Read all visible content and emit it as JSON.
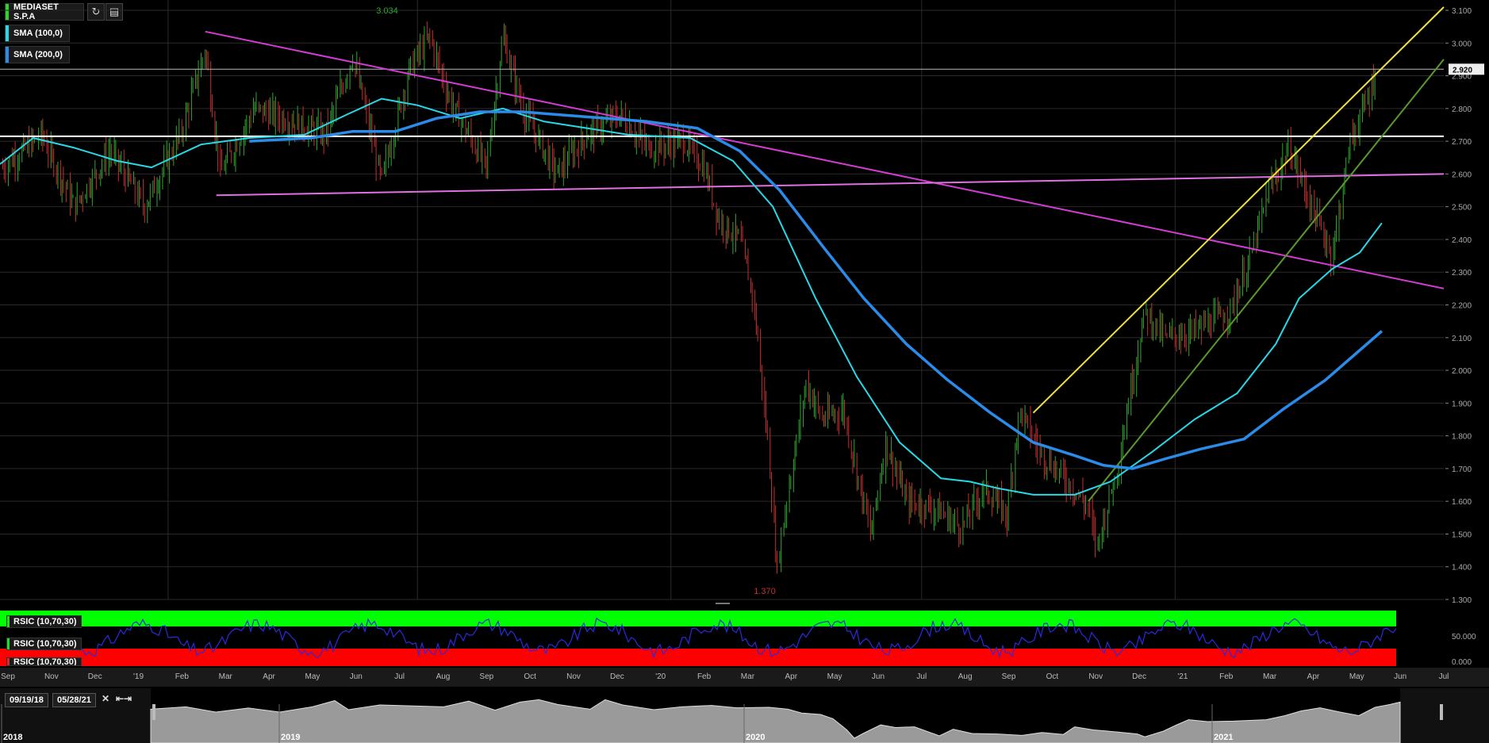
{
  "header": {
    "symbol": "MEDIASET S.P.A",
    "refresh_icon": "refresh-icon",
    "settings_icon": "chart-settings-icon",
    "legend": [
      {
        "label": "SMA (100,0)",
        "color": "#27d8e8"
      },
      {
        "label": "SMA (200,0)",
        "color": "#2a8be8"
      }
    ]
  },
  "chart_data": {
    "type": "candlestick",
    "title": "",
    "y_axis": {
      "ticks": [
        "3.100",
        "3.000",
        "2.900",
        "2.800",
        "2.700",
        "2.600",
        "2.500",
        "2.400",
        "2.300",
        "2.200",
        "2.100",
        "2.000",
        "1.900",
        "1.800",
        "1.700",
        "1.600",
        "1.500",
        "1.400",
        "1.300"
      ],
      "ylim": [
        1.3,
        3.1
      ]
    },
    "last_price": "2.920",
    "annotations": {
      "high": "3.034",
      "low": "1.370"
    },
    "x_axis": {
      "labels": [
        "Sep",
        "Nov",
        "Dec",
        "'19",
        "Feb",
        "Mar",
        "Apr",
        "May",
        "Jun",
        "Jul",
        "Aug",
        "Sep",
        "Oct",
        "Nov",
        "Dec",
        "'20",
        "Feb",
        "Mar",
        "Apr",
        "May",
        "Jun",
        "Jul",
        "Aug",
        "Sep",
        "Oct",
        "Nov",
        "Dec",
        "'21",
        "Feb",
        "Mar",
        "Apr",
        "May",
        "Jun",
        "Jul"
      ],
      "start": "2018-09-01",
      "end": "2021-07-15"
    },
    "price_series": [
      {
        "date": "2018-09-03",
        "close": 2.62
      },
      {
        "date": "2018-10-01",
        "close": 2.72
      },
      {
        "date": "2018-10-25",
        "close": 2.5
      },
      {
        "date": "2018-11-20",
        "close": 2.67
      },
      {
        "date": "2018-12-15",
        "close": 2.5
      },
      {
        "date": "2019-01-10",
        "close": 2.72
      },
      {
        "date": "2019-01-28",
        "close": 2.98
      },
      {
        "date": "2019-02-08",
        "close": 2.6
      },
      {
        "date": "2019-03-05",
        "close": 2.8
      },
      {
        "date": "2019-04-01",
        "close": 2.76
      },
      {
        "date": "2019-04-25",
        "close": 2.72
      },
      {
        "date": "2019-05-15",
        "close": 2.96
      },
      {
        "date": "2019-06-05",
        "close": 2.58
      },
      {
        "date": "2019-06-25",
        "close": 2.92
      },
      {
        "date": "2019-07-10",
        "close": 3.02
      },
      {
        "date": "2019-07-25",
        "close": 2.82
      },
      {
        "date": "2019-08-20",
        "close": 2.62
      },
      {
        "date": "2019-09-01",
        "close": 3.02
      },
      {
        "date": "2019-09-15",
        "close": 2.8
      },
      {
        "date": "2019-10-10",
        "close": 2.6
      },
      {
        "date": "2019-11-01",
        "close": 2.72
      },
      {
        "date": "2019-11-25",
        "close": 2.78
      },
      {
        "date": "2019-12-15",
        "close": 2.68
      },
      {
        "date": "2020-01-10",
        "close": 2.7
      },
      {
        "date": "2020-01-25",
        "close": 2.62
      },
      {
        "date": "2020-02-05",
        "close": 2.46
      },
      {
        "date": "2020-02-20",
        "close": 2.4
      },
      {
        "date": "2020-03-01",
        "close": 2.22
      },
      {
        "date": "2020-03-12",
        "close": 1.75
      },
      {
        "date": "2020-03-18",
        "close": 1.4
      },
      {
        "date": "2020-03-25",
        "close": 1.6
      },
      {
        "date": "2020-04-08",
        "close": 1.96
      },
      {
        "date": "2020-04-20",
        "close": 1.85
      },
      {
        "date": "2020-05-05",
        "close": 1.88
      },
      {
        "date": "2020-05-25",
        "close": 1.5
      },
      {
        "date": "2020-06-05",
        "close": 1.78
      },
      {
        "date": "2020-06-20",
        "close": 1.6
      },
      {
        "date": "2020-07-10",
        "close": 1.58
      },
      {
        "date": "2020-07-30",
        "close": 1.52
      },
      {
        "date": "2020-08-15",
        "close": 1.64
      },
      {
        "date": "2020-09-01",
        "close": 1.56
      },
      {
        "date": "2020-09-10",
        "close": 1.88
      },
      {
        "date": "2020-09-25",
        "close": 1.75
      },
      {
        "date": "2020-10-15",
        "close": 1.66
      },
      {
        "date": "2020-10-30",
        "close": 1.58
      },
      {
        "date": "2020-11-05",
        "close": 1.46
      },
      {
        "date": "2020-11-20",
        "close": 1.7
      },
      {
        "date": "2020-11-30",
        "close": 1.95
      },
      {
        "date": "2020-12-10",
        "close": 2.18
      },
      {
        "date": "2020-12-25",
        "close": 2.1
      },
      {
        "date": "2021-01-15",
        "close": 2.12
      },
      {
        "date": "2021-02-10",
        "close": 2.18
      },
      {
        "date": "2021-02-25",
        "close": 2.35
      },
      {
        "date": "2021-03-10",
        "close": 2.55
      },
      {
        "date": "2021-03-25",
        "close": 2.68
      },
      {
        "date": "2021-04-10",
        "close": 2.5
      },
      {
        "date": "2021-04-25",
        "close": 2.35
      },
      {
        "date": "2021-05-08",
        "close": 2.7
      },
      {
        "date": "2021-05-20",
        "close": 2.82
      },
      {
        "date": "2021-05-28",
        "close": 2.92
      }
    ],
    "sma100": [
      {
        "date": "2018-09-01",
        "value": 2.63
      },
      {
        "date": "2018-09-25",
        "value": 2.71
      },
      {
        "date": "2018-10-25",
        "value": 2.68
      },
      {
        "date": "2018-11-25",
        "value": 2.64
      },
      {
        "date": "2018-12-20",
        "value": 2.62
      },
      {
        "date": "2019-01-25",
        "value": 2.69
      },
      {
        "date": "2019-03-01",
        "value": 2.71
      },
      {
        "date": "2019-04-10",
        "value": 2.72
      },
      {
        "date": "2019-05-10",
        "value": 2.78
      },
      {
        "date": "2019-06-05",
        "value": 2.83
      },
      {
        "date": "2019-07-01",
        "value": 2.81
      },
      {
        "date": "2019-08-01",
        "value": 2.77
      },
      {
        "date": "2019-09-01",
        "value": 2.8
      },
      {
        "date": "2019-10-01",
        "value": 2.76
      },
      {
        "date": "2019-11-01",
        "value": 2.74
      },
      {
        "date": "2019-12-01",
        "value": 2.72
      },
      {
        "date": "2020-01-15",
        "value": 2.71
      },
      {
        "date": "2020-02-15",
        "value": 2.64
      },
      {
        "date": "2020-03-15",
        "value": 2.5
      },
      {
        "date": "2020-04-15",
        "value": 2.22
      },
      {
        "date": "2020-05-15",
        "value": 1.98
      },
      {
        "date": "2020-06-15",
        "value": 1.78
      },
      {
        "date": "2020-07-15",
        "value": 1.67
      },
      {
        "date": "2020-08-05",
        "value": 1.66
      },
      {
        "date": "2020-08-25",
        "value": 1.64
      },
      {
        "date": "2020-09-20",
        "value": 1.62
      },
      {
        "date": "2020-10-20",
        "value": 1.62
      },
      {
        "date": "2020-11-15",
        "value": 1.66
      },
      {
        "date": "2020-12-15",
        "value": 1.75
      },
      {
        "date": "2021-01-15",
        "value": 1.85
      },
      {
        "date": "2021-02-15",
        "value": 1.93
      },
      {
        "date": "2021-03-15",
        "value": 2.08
      },
      {
        "date": "2021-04-01",
        "value": 2.22
      },
      {
        "date": "2021-04-25",
        "value": 2.31
      },
      {
        "date": "2021-05-15",
        "value": 2.36
      },
      {
        "date": "2021-05-31",
        "value": 2.45
      }
    ],
    "sma200": [
      {
        "date": "2019-03-01",
        "value": 2.7
      },
      {
        "date": "2019-04-15",
        "value": 2.71
      },
      {
        "date": "2019-05-15",
        "value": 2.73
      },
      {
        "date": "2019-06-15",
        "value": 2.73
      },
      {
        "date": "2019-07-15",
        "value": 2.77
      },
      {
        "date": "2019-08-15",
        "value": 2.79
      },
      {
        "date": "2019-09-15",
        "value": 2.79
      },
      {
        "date": "2019-10-15",
        "value": 2.78
      },
      {
        "date": "2019-11-15",
        "value": 2.77
      },
      {
        "date": "2019-12-15",
        "value": 2.76
      },
      {
        "date": "2020-01-20",
        "value": 2.74
      },
      {
        "date": "2020-02-20",
        "value": 2.67
      },
      {
        "date": "2020-03-20",
        "value": 2.55
      },
      {
        "date": "2020-04-20",
        "value": 2.38
      },
      {
        "date": "2020-05-20",
        "value": 2.22
      },
      {
        "date": "2020-06-20",
        "value": 2.08
      },
      {
        "date": "2020-07-20",
        "value": 1.97
      },
      {
        "date": "2020-08-20",
        "value": 1.87
      },
      {
        "date": "2020-09-20",
        "value": 1.78
      },
      {
        "date": "2020-10-20",
        "value": 1.74
      },
      {
        "date": "2020-11-10",
        "value": 1.71
      },
      {
        "date": "2020-12-01",
        "value": 1.7
      },
      {
        "date": "2020-12-25",
        "value": 1.73
      },
      {
        "date": "2021-01-20",
        "value": 1.76
      },
      {
        "date": "2021-02-20",
        "value": 1.79
      },
      {
        "date": "2021-03-20",
        "value": 1.88
      },
      {
        "date": "2021-04-20",
        "value": 1.97
      },
      {
        "date": "2021-05-31",
        "value": 2.12
      }
    ],
    "horizontal_lines": [
      {
        "value": 2.92,
        "color": "#bbbbbb"
      },
      {
        "value": 2.715,
        "color": "#ffffff"
      }
    ],
    "trend_lines": [
      {
        "from": {
          "date": "2019-01-28",
          "value": 3.035
        },
        "to": {
          "date": "2021-07-15",
          "value": 2.25
        },
        "color": "#d23cd2"
      },
      {
        "from": {
          "date": "2019-02-05",
          "value": 2.535
        },
        "to": {
          "date": "2021-07-15",
          "value": 2.6
        },
        "color": "#e070e0"
      },
      {
        "from": {
          "date": "2020-09-20",
          "value": 1.87
        },
        "to": {
          "date": "2021-07-15",
          "value": 3.11
        },
        "color": "#f0e040"
      },
      {
        "from": {
          "date": "2020-10-30",
          "value": 1.6
        },
        "to": {
          "date": "2021-07-15",
          "value": 2.95
        },
        "color": "#5a9a2a"
      }
    ]
  },
  "rsi": {
    "labels": [
      "RSIC (10,70,30)",
      "RSIC (10,70,30)",
      "RSIC (10,70,30)"
    ],
    "label_colors": [
      "#28d828",
      "#28d828",
      "#d82828"
    ],
    "ticks": [
      "50.000",
      "0.000"
    ],
    "overbought_color": "#00ff00",
    "oversold_color": "#ff0000",
    "line_color": "#2a2adf"
  },
  "navigator": {
    "start_date": "09/19/18",
    "end_date": "05/28/21",
    "close_icon": "close-icon",
    "expand_icon": "expand-icon",
    "year_labels": [
      "2018",
      "2019",
      "2020",
      "2021"
    ]
  }
}
